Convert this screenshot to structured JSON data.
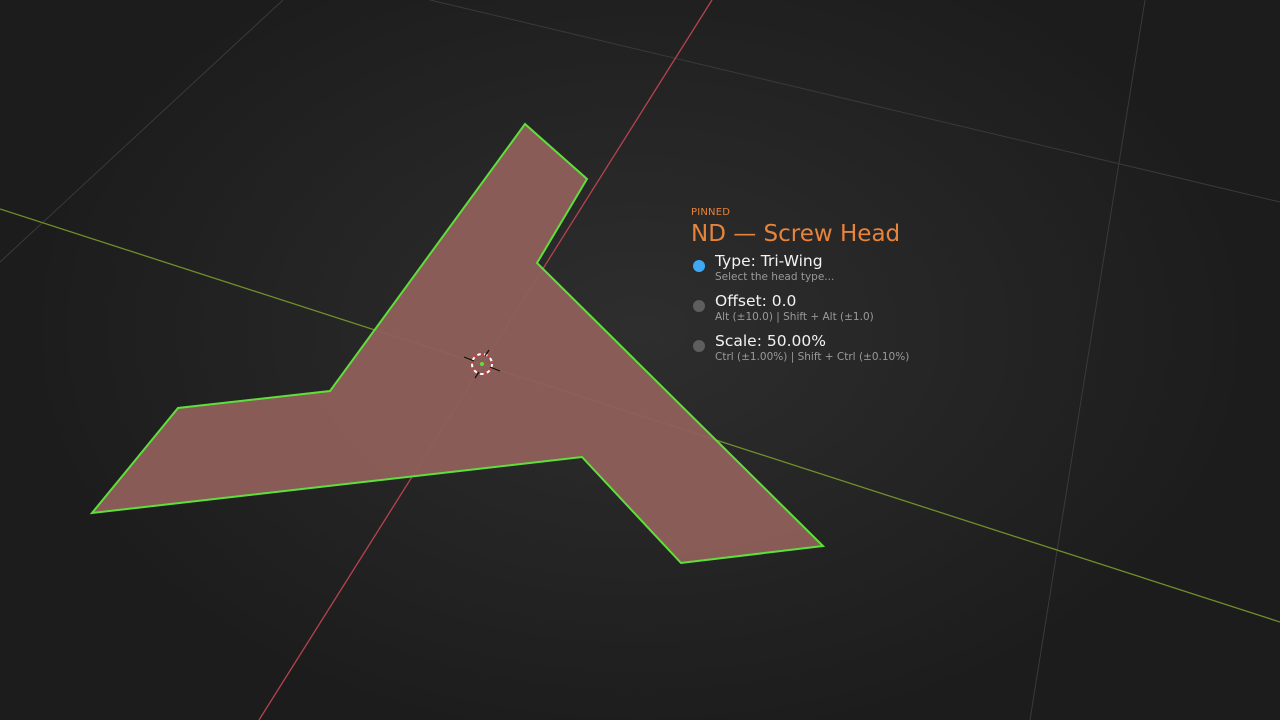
{
  "hud": {
    "pinned": "PINNED",
    "title": "ND — Screw Head",
    "options": [
      {
        "label": "Type: Tri-Wing",
        "hint": "Select the head type...",
        "active": true
      },
      {
        "label": "Offset: 0.0",
        "hint": "Alt (±10.0)  |  Shift + Alt (±1.0)",
        "active": false
      },
      {
        "label": "Scale: 50.00%",
        "hint": "Ctrl (±1.00%)  |  Shift + Ctrl (±0.10%)",
        "active": false
      }
    ]
  },
  "colors": {
    "accent_orange": "#e8833a",
    "active_dot": "#3da9f5",
    "inactive_dot": "#5e5e5e",
    "x_axis": "#b5434e",
    "y_axis": "#6e8f2a",
    "shape_fill": "#8f5f5a",
    "selection_outline": "#5ee03a"
  },
  "icons": {
    "cursor": "3d-cursor-icon"
  }
}
